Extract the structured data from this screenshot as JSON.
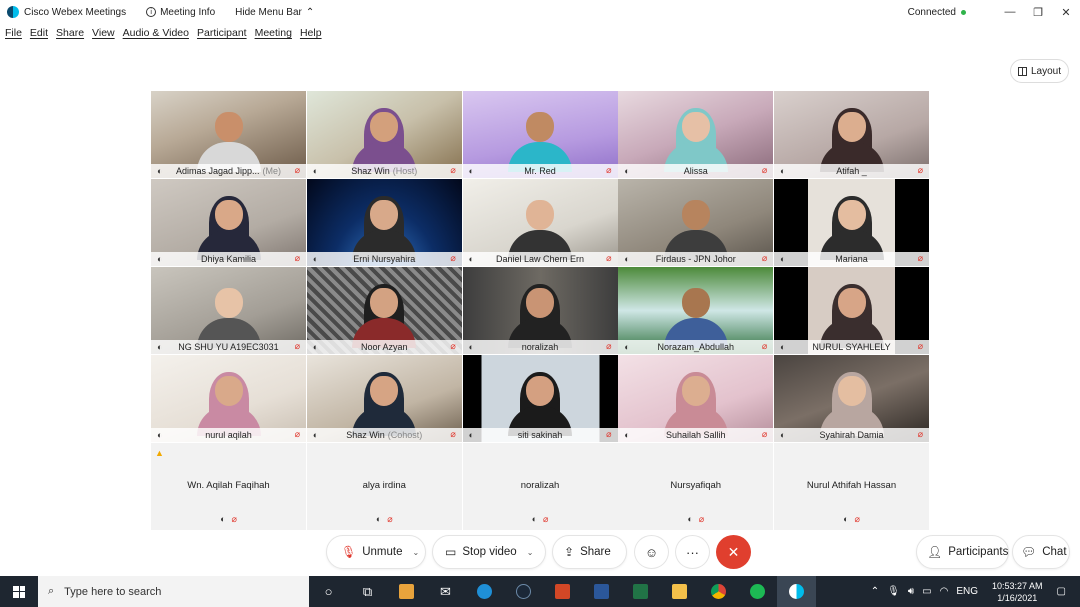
{
  "titlebar": {
    "app_title": "Cisco Webex Meetings",
    "meeting_info": "Meeting Info",
    "hide_menu": "Hide Menu Bar",
    "status": "Connected",
    "status_color": "#2fb34a"
  },
  "menu": [
    "File",
    "Edit",
    "Share",
    "View",
    "Audio & Video",
    "Participant",
    "Meeting",
    "Help"
  ],
  "layout_button": "Layout",
  "video_tiles": [
    {
      "name": "Adimas Jagad Jipp...",
      "role": "(Me)",
      "bg": "bg-a",
      "skin": "#c98f6a",
      "hijab": "",
      "shirt": "#d8d8d8"
    },
    {
      "name": "Shaz Win",
      "role": "(Host)",
      "bg": "bg-b",
      "skin": "#d3a07c",
      "hijab": "#7b4f8e",
      "shirt": "#7b4f8e"
    },
    {
      "name": "Mr. Red",
      "role": "",
      "bg": "bg-c",
      "skin": "#c08a62",
      "hijab": "",
      "shirt": "#2bb6c9"
    },
    {
      "name": "Alissa",
      "role": "",
      "bg": "bg-d",
      "skin": "#e6c0a6",
      "hijab": "#7fc8c8",
      "shirt": "#7fc8c8"
    },
    {
      "name": "Atifah _",
      "role": "",
      "bg": "bg-e",
      "skin": "#dcae8f",
      "hijab": "#3a2a2a",
      "shirt": "#3a2a2a"
    },
    {
      "name": "Dhiya Kamilia",
      "role": "",
      "bg": "bg-f",
      "skin": "#d9a888",
      "hijab": "#26283a",
      "shirt": "#26283a"
    },
    {
      "name": "Erni Nursyahira",
      "role": "",
      "bg": "bg-g",
      "skin": "#d8a98a",
      "hijab": "#2b2b2b",
      "shirt": "#2b2b2b"
    },
    {
      "name": "Daniel Law Chern Ern",
      "role": "",
      "bg": "bg-h",
      "skin": "#e0b496",
      "hijab": "",
      "shirt": "#333333"
    },
    {
      "name": "Firdaus - JPN Johor",
      "role": "",
      "bg": "bg-i",
      "skin": "#b7845e",
      "hijab": "",
      "shirt": "#3d3d3d"
    },
    {
      "name": "Mariana",
      "role": "",
      "bg": "bg-j",
      "skin": "#e4bda0",
      "hijab": "#2c2c2c",
      "shirt": "#2c2c2c"
    },
    {
      "name": "NG SHU YU A19EC3031",
      "role": "",
      "bg": "bg-k",
      "skin": "#e7c3a7",
      "hijab": "",
      "shirt": "#555555"
    },
    {
      "name": "Noor Azyan",
      "role": "",
      "bg": "bg-l",
      "skin": "#d3a282",
      "hijab": "#1f1f1f",
      "shirt": "#8a2a2a"
    },
    {
      "name": "noralizah",
      "role": "",
      "bg": "bg-m",
      "skin": "#c99474",
      "hijab": "#222222",
      "shirt": "#222222"
    },
    {
      "name": "Norazam_Abdullah",
      "role": "",
      "bg": "bg-n",
      "skin": "#a8764f",
      "hijab": "",
      "shirt": "#3e5f9a"
    },
    {
      "name": "NURUL SYAHLELY",
      "role": "",
      "bg": "bg-o",
      "skin": "#d7a587",
      "hijab": "#3a2e2e",
      "shirt": "#3a2e2e"
    },
    {
      "name": "nurul aqilah",
      "role": "",
      "bg": "bg-p",
      "skin": "#d9a98a",
      "hijab": "#c98aa3",
      "shirt": "#c98aa3"
    },
    {
      "name": "Shaz Win",
      "role": "(Cohost)",
      "bg": "bg-q",
      "skin": "#d6a484",
      "hijab": "#1f2a3a",
      "shirt": "#1f2a3a"
    },
    {
      "name": "siti sakinah",
      "role": "",
      "bg": "bg-r",
      "skin": "#d4a081",
      "hijab": "#1b1b1b",
      "shirt": "#1b1b1b"
    },
    {
      "name": "Suhailah Sallih",
      "role": "",
      "bg": "bg-s",
      "skin": "#dcae90",
      "hijab": "#c98b96",
      "shirt": "#c98b96"
    },
    {
      "name": "Syahirah Damia",
      "role": "",
      "bg": "bg-t",
      "skin": "#e4bea1",
      "hijab": "#b8a6a0",
      "shirt": "#b8a6a0"
    }
  ],
  "audio_tiles": [
    {
      "name": "Wn. Aqilah Faqihah",
      "warning": true
    },
    {
      "name": "alya irdina",
      "warning": false
    },
    {
      "name": "noralizah",
      "warning": false
    },
    {
      "name": "Nursyafiqah",
      "warning": false
    },
    {
      "name": "Nurul Athifah Hassan",
      "warning": false
    }
  ],
  "controls": {
    "unmute": "Unmute",
    "stop_video": "Stop video",
    "share": "Share",
    "participants": "Participants",
    "chat": "Chat"
  },
  "taskbar": {
    "search_placeholder": "Type here to search",
    "language": "ENG",
    "time": "10:53:27 AM",
    "date": "1/16/2021"
  }
}
